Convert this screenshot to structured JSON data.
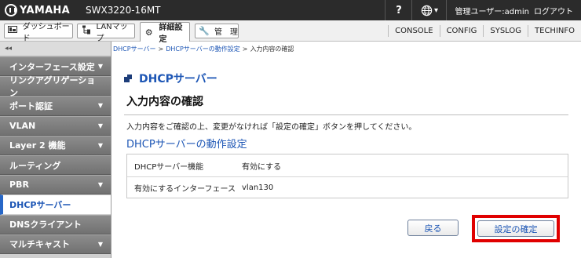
{
  "header": {
    "brand": "YAMAHA",
    "model": "SWX3220-16MT",
    "help_label": "?",
    "language_caret": "▾",
    "user_label": "管理ユーザー:admin",
    "logout_label": "ログアウト"
  },
  "tabs": [
    {
      "label": "ダッシュボード",
      "icon": "dashboard-icon",
      "active": false
    },
    {
      "label": "LANマップ",
      "icon": "lan-map-icon",
      "active": false
    },
    {
      "label": "詳細設定",
      "icon": "gear-icon",
      "active": true
    },
    {
      "label": "管　理",
      "icon": "wrench-icon",
      "active": false
    }
  ],
  "tools": [
    "CONSOLE",
    "CONFIG",
    "SYSLOG",
    "TECHINFO"
  ],
  "sidebar": {
    "collapse_label": "◂◂",
    "items": [
      {
        "label": "インターフェース設定",
        "caret": "▼"
      },
      {
        "label": "リンクアグリゲーション",
        "caret": ""
      },
      {
        "label": "ポート認証",
        "caret": "▼"
      },
      {
        "label": "VLAN",
        "caret": "▼"
      },
      {
        "label": "Layer 2 機能",
        "caret": "▼"
      },
      {
        "label": "ルーティング",
        "caret": ""
      },
      {
        "label": "PBR",
        "caret": "▼"
      },
      {
        "label": "DHCPサーバー",
        "caret": ""
      },
      {
        "label": "DNSクライアント",
        "caret": ""
      },
      {
        "label": "マルチキャスト",
        "caret": "▼"
      }
    ],
    "active_index": 7
  },
  "breadcrumb": {
    "items": [
      "DHCPサーバー",
      "DHCPサーバーの動作設定",
      "入力内容の確認"
    ],
    "separator": ">"
  },
  "main": {
    "page_title": "DHCPサーバー",
    "section_title": "入力内容の確認",
    "description": "入力内容をご確認の上、変更がなければ「設定の確定」ボタンを押してください。",
    "subsection_title": "DHCPサーバーの動作設定",
    "settings": [
      {
        "label": "DHCPサーバー機能",
        "value": "有効にする"
      },
      {
        "label": "有効にするインターフェース",
        "value": "vlan130"
      }
    ],
    "back_label": "戻る",
    "confirm_label": "設定の確定"
  },
  "colors": {
    "accent": "#1d56b5",
    "header_bg": "#2b2b2b",
    "highlight_border": "#e00000"
  }
}
